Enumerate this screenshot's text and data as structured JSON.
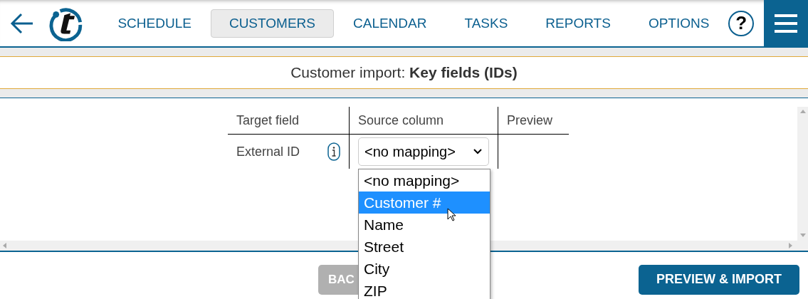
{
  "nav": {
    "tabs": [
      {
        "label": "SCHEDULE",
        "selected": false
      },
      {
        "label": "CUSTOMERS",
        "selected": true
      },
      {
        "label": "CALENDAR",
        "selected": false
      },
      {
        "label": "TASKS",
        "selected": false
      },
      {
        "label": "REPORTS",
        "selected": false
      },
      {
        "label": "OPTIONS",
        "selected": false
      }
    ],
    "help": "?"
  },
  "title": "Customer import: **Key fields (IDs)**",
  "table": {
    "columns": [
      "Target field",
      "Source column",
      "Preview"
    ],
    "rows": [
      {
        "target": "External ID",
        "source": "<no mapping>"
      }
    ]
  },
  "dropdown": {
    "options": [
      {
        "label": "<no mapping>",
        "selected": false
      },
      {
        "label": "Customer #",
        "selected": true
      },
      {
        "label": "Name",
        "selected": false
      },
      {
        "label": "Street",
        "selected": false
      },
      {
        "label": "City",
        "selected": false
      },
      {
        "label": "ZIP",
        "selected": false
      }
    ]
  },
  "buttons": {
    "back": "BAC",
    "import": "PREVIEW & IMPORT"
  }
}
